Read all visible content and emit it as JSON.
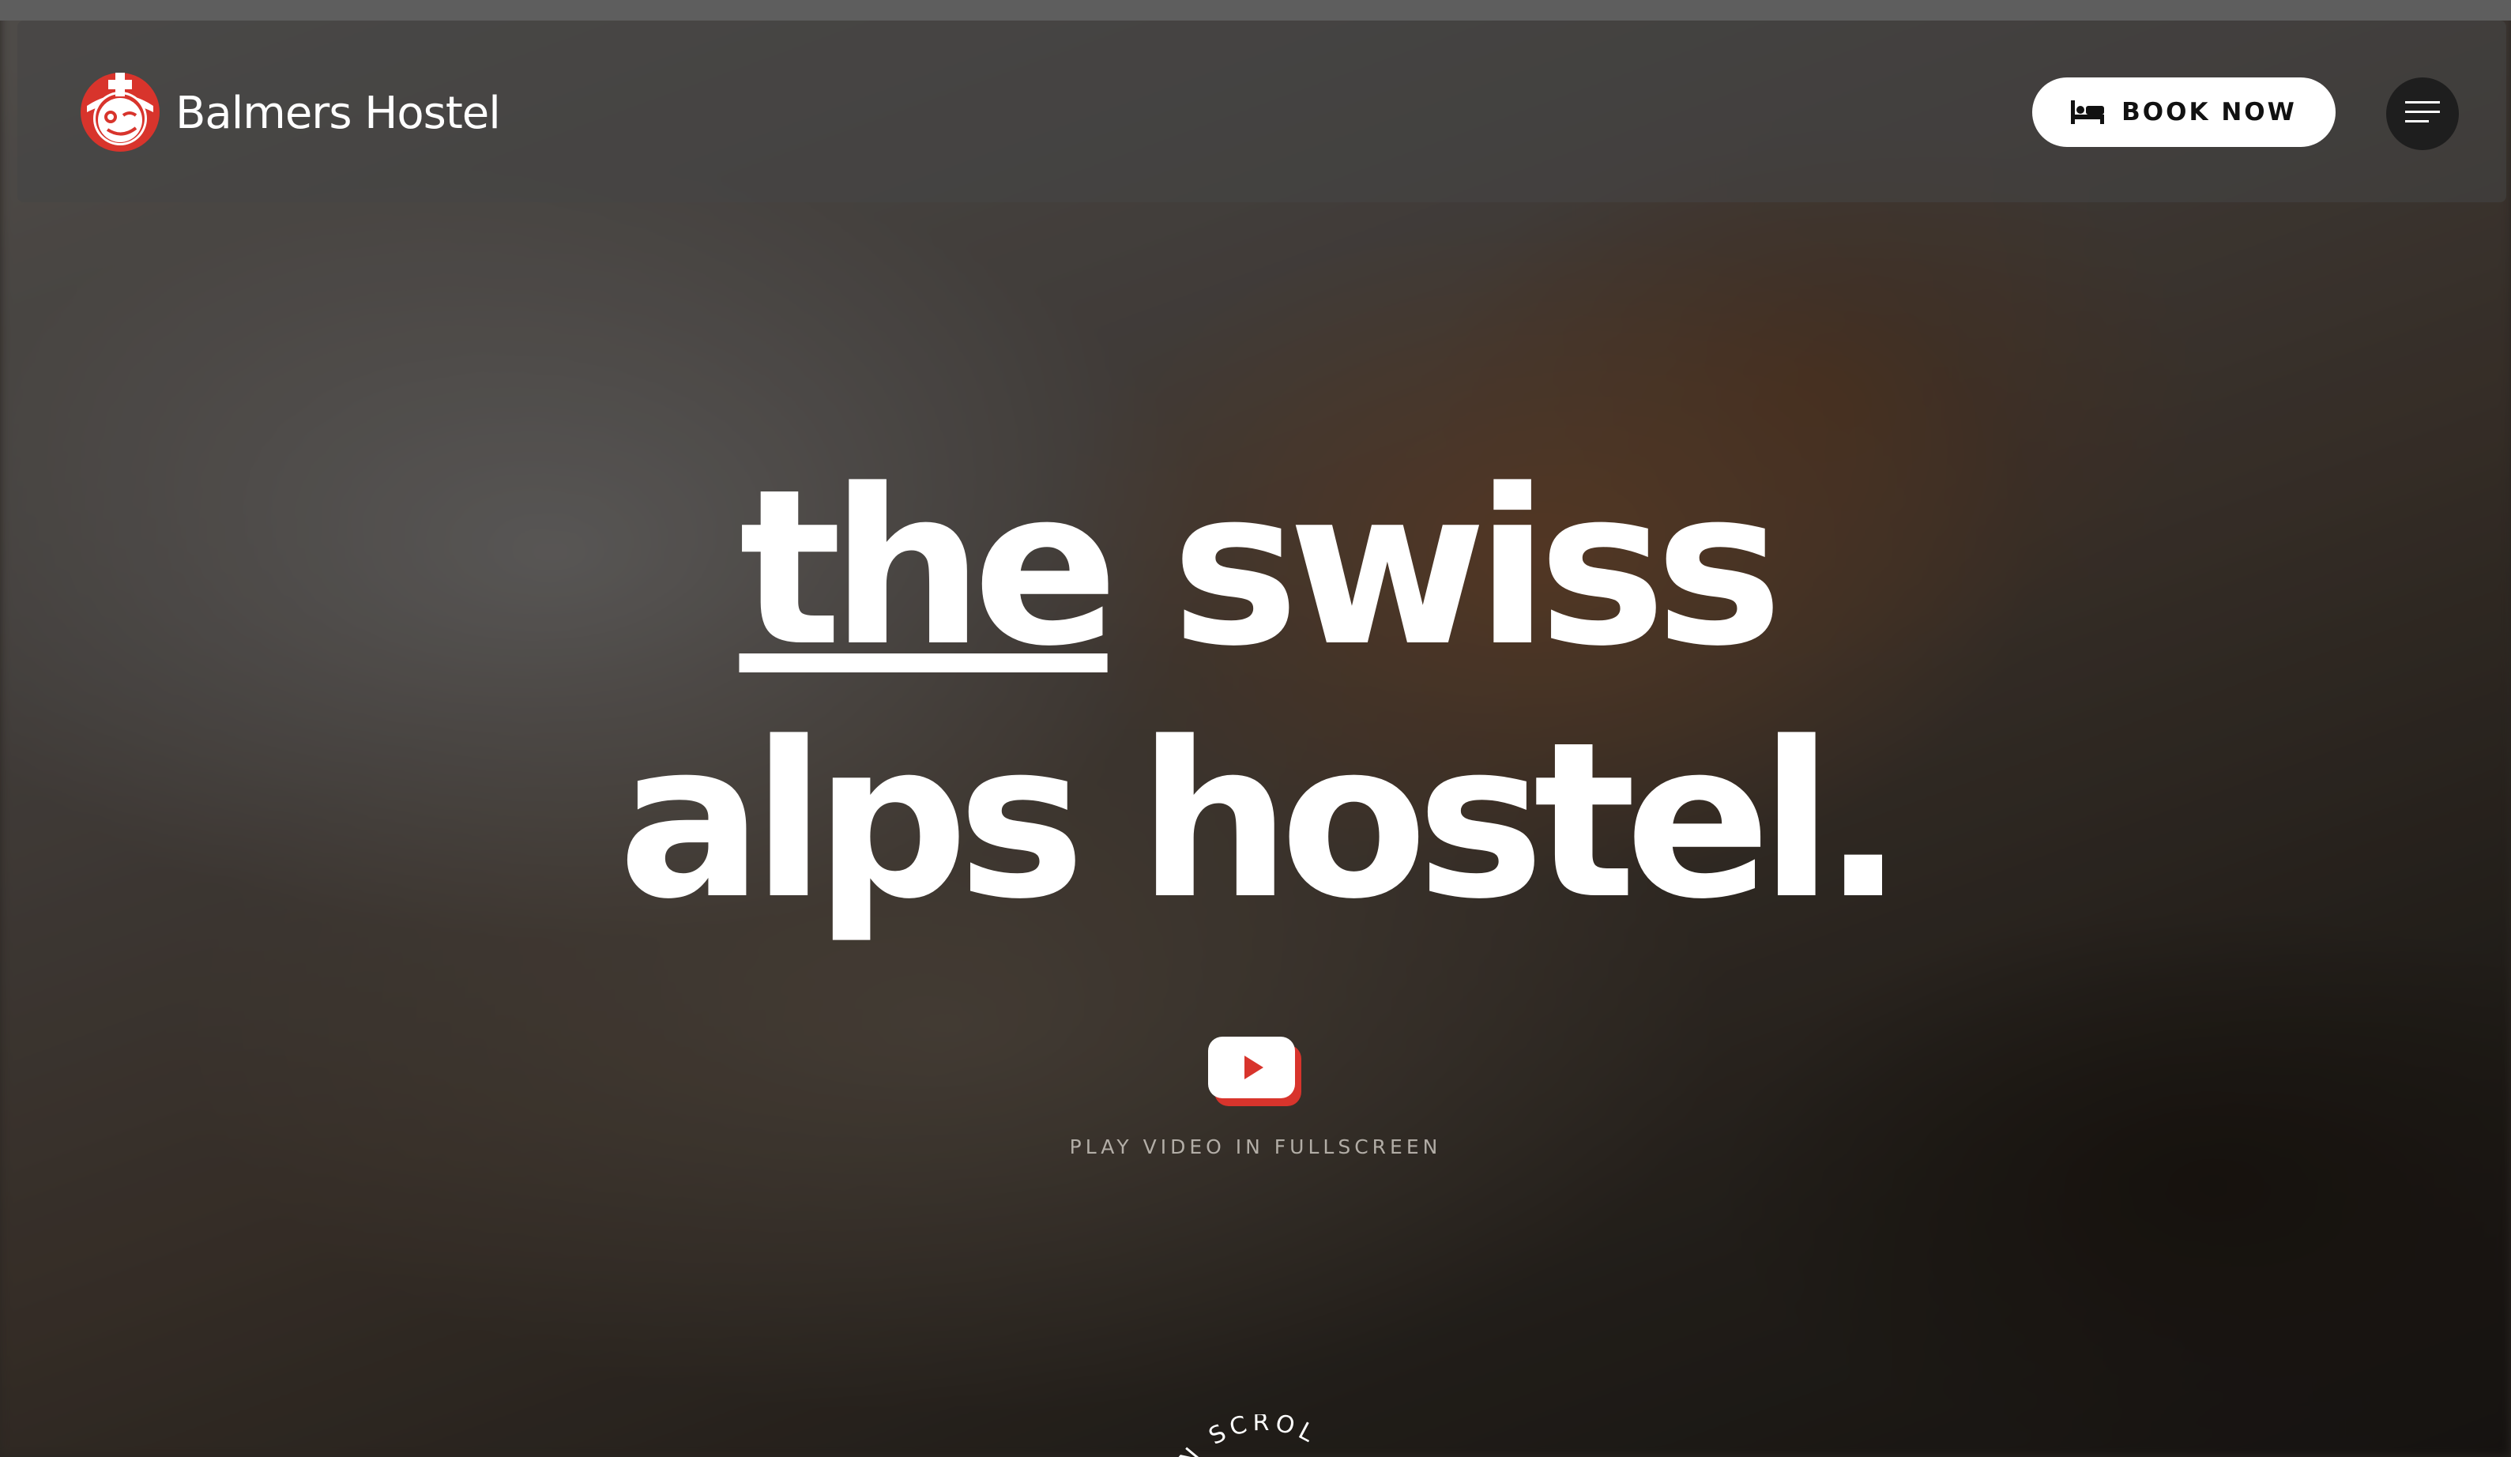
{
  "header": {
    "brand_name": "Balmers Hostel",
    "book_label": "BOOK NOW",
    "icons": {
      "logo": "balmers-mascot-logo",
      "book": "bed-icon",
      "menu": "hamburger-menu-icon"
    }
  },
  "hero": {
    "headline_line1_a": "the",
    "headline_line1_b": "swiss",
    "headline_line2": "alps hostel.",
    "play_label": "PLAY VIDEO IN FULLSCREEN",
    "play_icon": "youtube-play-icon",
    "scroll_text": "N SCROL"
  },
  "colors": {
    "brand_red": "#d8342c",
    "button_bg": "#ffffff",
    "menu_bg": "#1e1e1e",
    "text": "#ffffff"
  }
}
